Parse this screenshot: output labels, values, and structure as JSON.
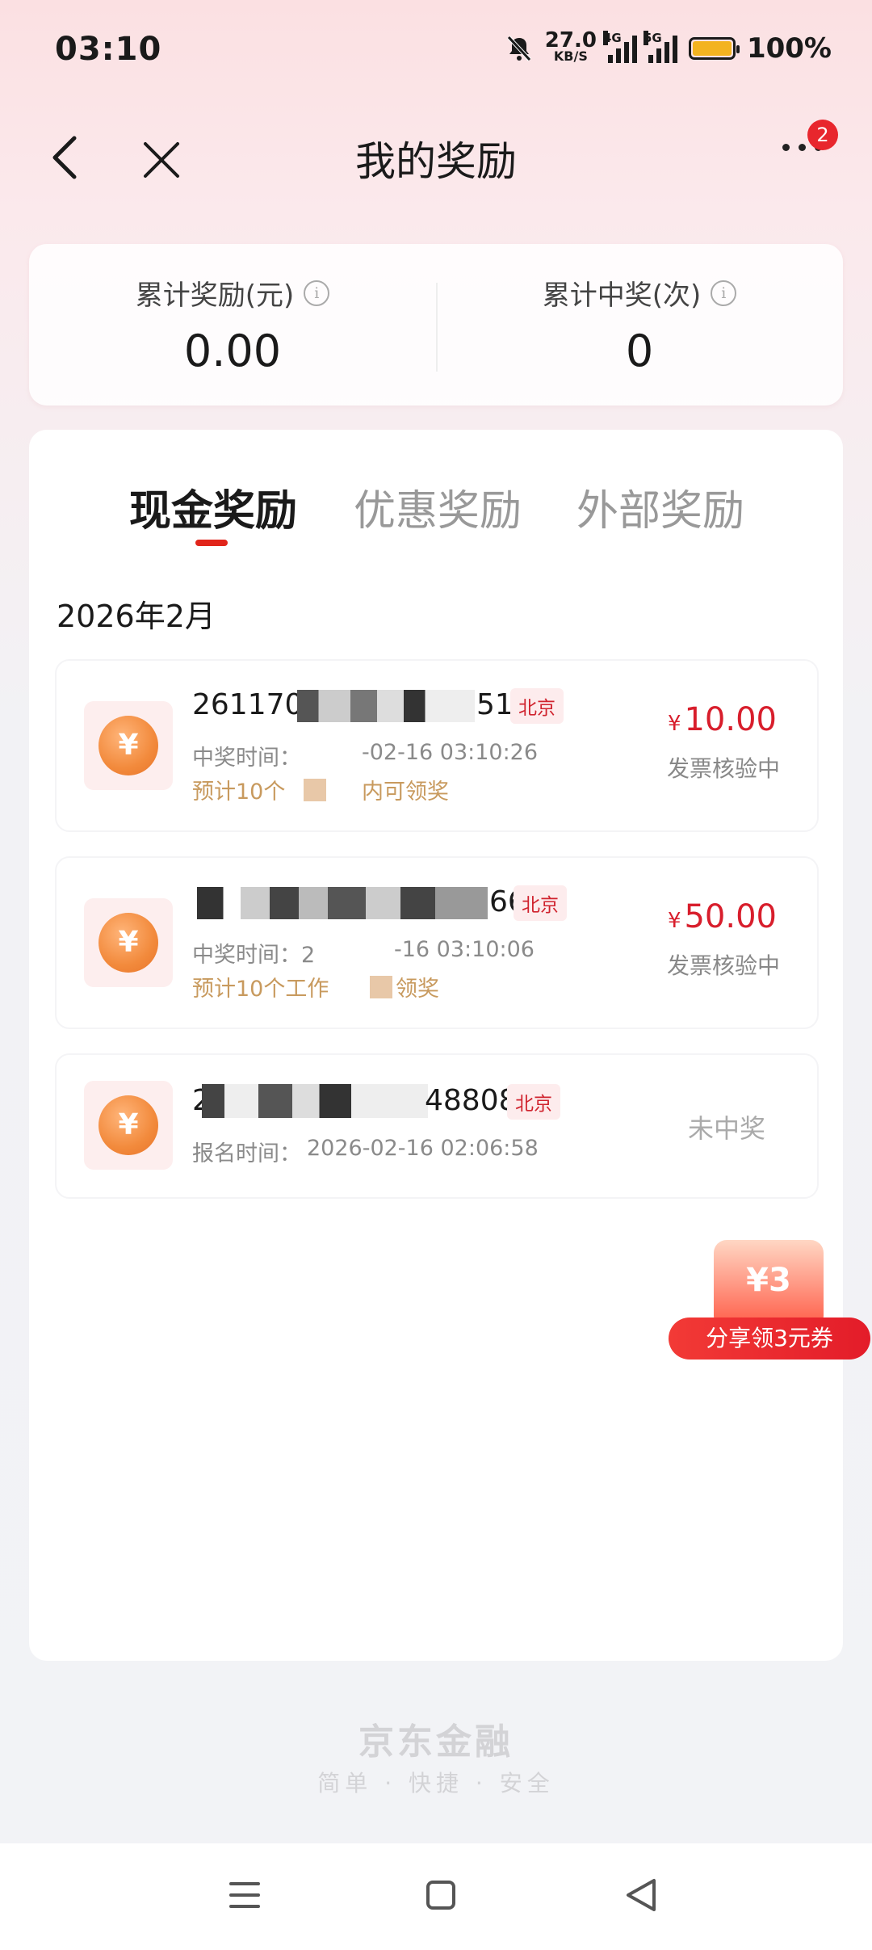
{
  "status": {
    "time": "03:10",
    "speed_value": "27.0",
    "speed_unit": "KB/S",
    "net1": "4G",
    "net2": "5G",
    "battery": "100%"
  },
  "nav": {
    "title": "我的奖励",
    "badge": "2"
  },
  "summary": {
    "total_reward_label": "累计奖励(元)",
    "total_reward_value": "0.00",
    "total_wins_label": "累计中奖(次)",
    "total_wins_value": "0"
  },
  "tabs": [
    {
      "label": "现金奖励",
      "active": true
    },
    {
      "label": "优惠奖励",
      "active": false
    },
    {
      "label": "外部奖励",
      "active": false
    }
  ],
  "month": "2026年2月",
  "records": [
    {
      "title_prefix": "2611700",
      "title_suffix": "519",
      "city": "北京",
      "time_label": "中奖时间：",
      "time_value": "-02-16 03:10:26",
      "note_prefix": "预计10个",
      "note_suffix": "内可领奖",
      "currency": "¥",
      "amount": "10.00",
      "status": "发票核验中"
    },
    {
      "title_prefix": "",
      "title_suffix": "664",
      "city": "北京",
      "time_label": "中奖时间：2",
      "time_value": "-16 03:10:06",
      "note_prefix": "预计10个工作",
      "note_suffix": "领奖",
      "currency": "¥",
      "amount": "50.00",
      "status": "发票核验中"
    },
    {
      "title_prefix": "2",
      "title_suffix": "4880811",
      "city": "北京",
      "time_label": "报名时间：",
      "time_value": "2026-02-16 02:06:58",
      "status": "未中奖"
    }
  ],
  "share": {
    "box_text": "¥3",
    "button": "分享领3元券"
  },
  "footer": {
    "brand": "京东金融",
    "slogan": "简单 · 快捷 · 安全"
  },
  "icons": {
    "back": "chevron-left",
    "close": "x",
    "more": "ellipsis",
    "info": "info-circle",
    "coin": "yen-coin"
  },
  "colors": {
    "accent": "#e1251b",
    "amount": "#d81e2c",
    "note": "#c89a5e"
  }
}
